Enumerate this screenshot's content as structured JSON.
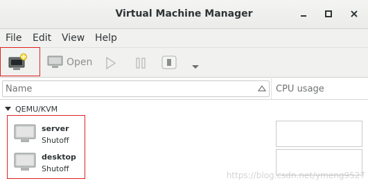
{
  "window": {
    "title": "Virtual Machine Manager",
    "controls": [
      "minimize-icon",
      "maximize-icon",
      "close-icon"
    ]
  },
  "menubar": {
    "items": [
      "File",
      "Edit",
      "View",
      "Help"
    ]
  },
  "toolbar": {
    "new_vm_icon": "new-vm-icon",
    "open_label": "Open",
    "open_icon": "monitor-icon",
    "run_icon": "play-icon",
    "pause_icon": "pause-icon",
    "shutdown_icon": "shutdown-icon",
    "menu_icon": "chevron-down-icon"
  },
  "columns": {
    "name": "Name",
    "cpu": "CPU usage"
  },
  "connection": {
    "label": "QEMU/KVM",
    "expanded": true
  },
  "vms": [
    {
      "name": "server",
      "status": "Shutoff"
    },
    {
      "name": "desktop",
      "status": "Shutoff"
    }
  ],
  "watermark": "https://blog.csdn.net/ymeng9527",
  "colors": {
    "highlight": "#e02020",
    "titlebar": "#ebebe9",
    "text": "#2e3436"
  }
}
